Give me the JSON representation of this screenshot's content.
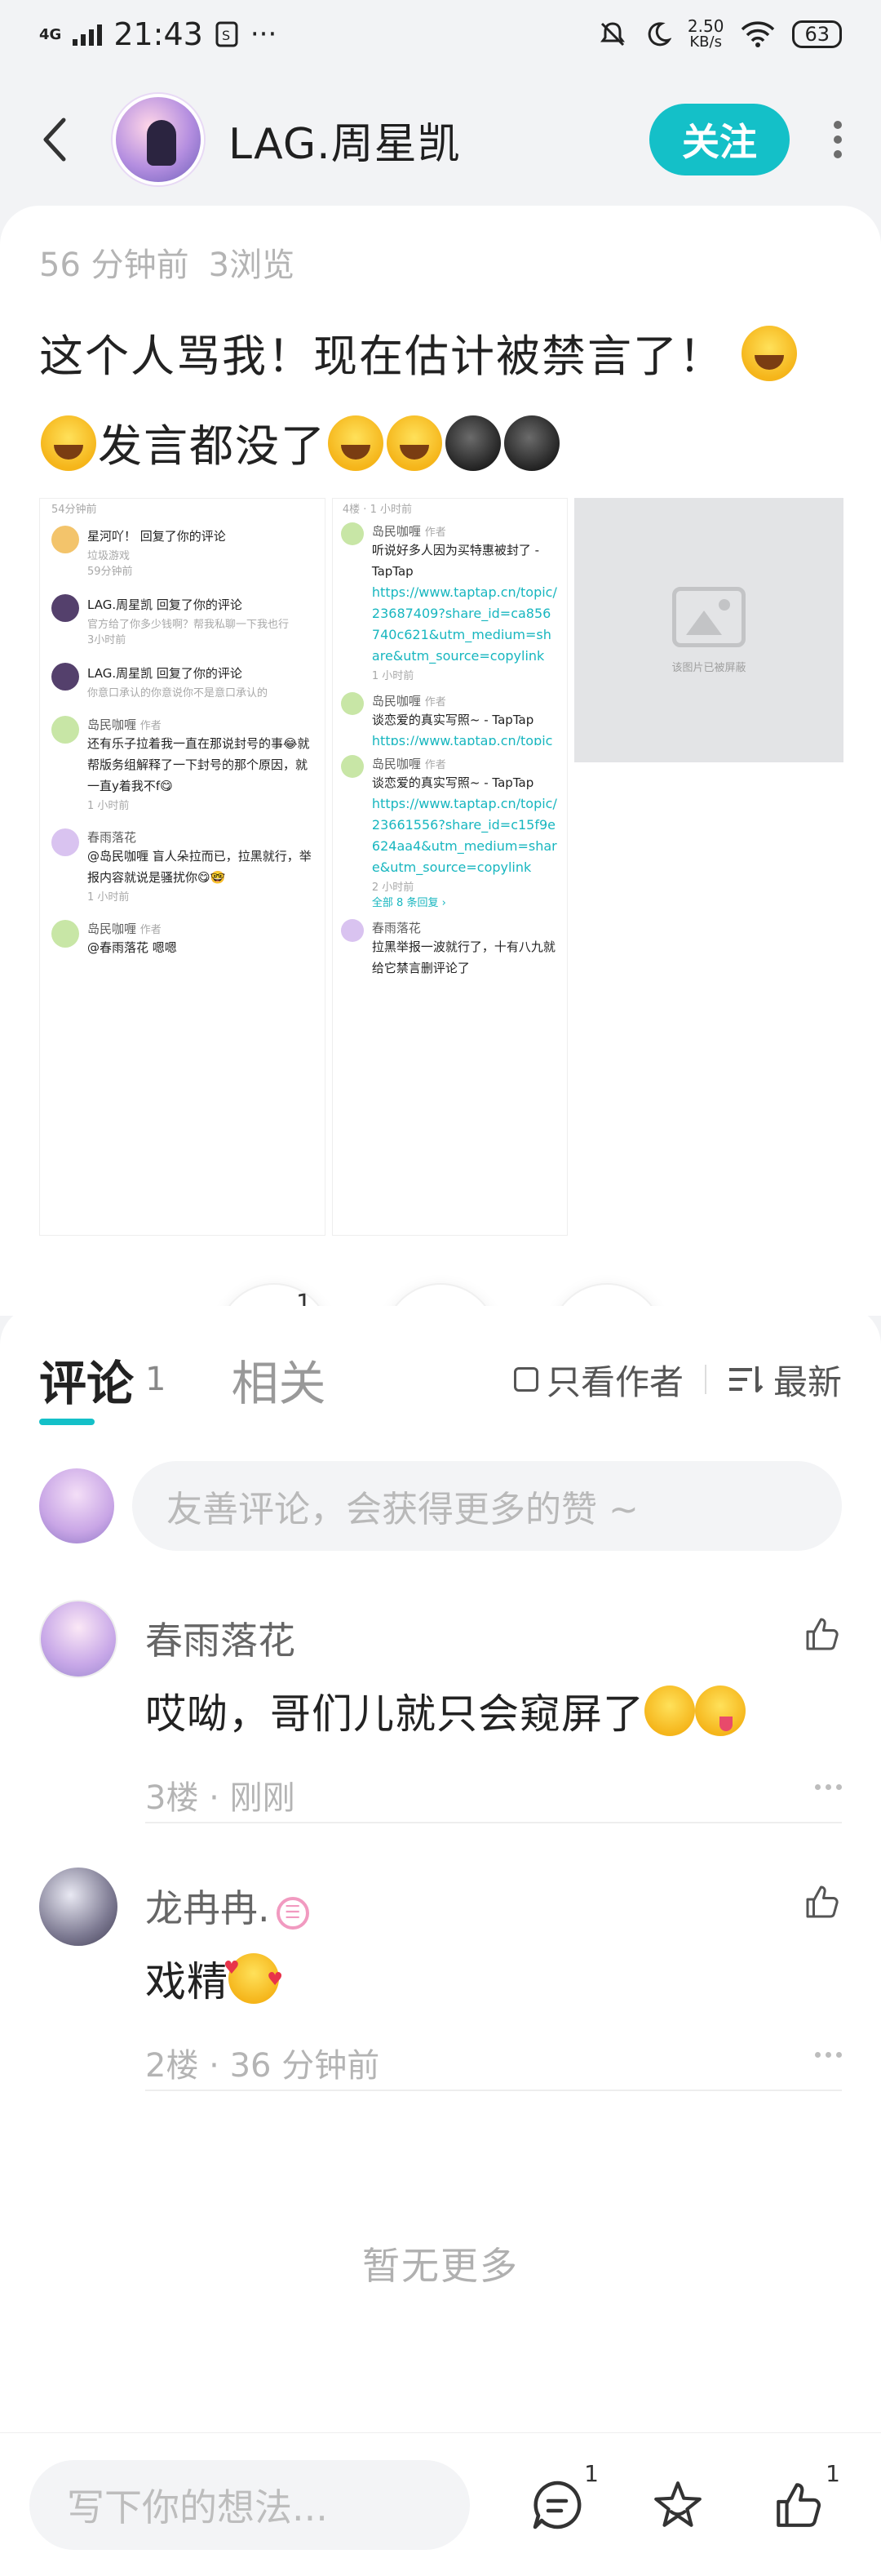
{
  "status_bar": {
    "network": "4G",
    "time": "21:43",
    "speed_value": "2.50",
    "speed_unit": "KB/s",
    "battery": "63"
  },
  "header": {
    "author_name": "LAG.周星凯",
    "follow_label": "关注"
  },
  "post": {
    "age": "56 分钟前",
    "views": "3浏览",
    "text_part1": "这个人骂我！现在估计被禁言了！",
    "text_part2": "发言都没了",
    "likes": "1"
  },
  "screenshot1": {
    "top_time": "54分钟前",
    "n1_title": "星河吖！ 回复了你的评论",
    "n1_text": "垃圾游戏",
    "n1_time": "59分钟前",
    "n2_title": "LAG.周星凯 回复了你的评论",
    "n2_text": "官方给了你多少钱啊？帮我私聊一下我也行",
    "n2_time": "3小时前",
    "n3_title": "LAG.周星凯 回复了你的评论",
    "n3_text": "你意口承认的你意说你不是意口承认的",
    "c1_name": "岛民咖喱",
    "c1_tag": "作者",
    "c1_text": "还有乐子拉着我一直在那说封号的事😂就帮版务组解释了一下封号的那个原因，就一直y着我不f😋",
    "c1_time": "1 小时前",
    "c2_name": "春雨落花",
    "c2_text": "@岛民咖喱 盲人朵拉而已，拉黑就行，举报内容就说是骚扰你😋🤓",
    "c2_time": "1 小时前",
    "c3_name": "岛民咖喱",
    "c3_tag": "作者",
    "c3_text": "@春雨落花  嗯嗯"
  },
  "screenshot2": {
    "top_meta": "4楼 · 1 小时前",
    "a_name": "岛民咖喱",
    "a_tag": "作者",
    "a_text": "听说好多人因为买特惠被封了 - TapTap",
    "a_link": "https://www.taptap.cn/topic/23687409?share_id=ca856740c621&utm_medium=share&utm_source=copylink",
    "a_time": "1 小时前",
    "b_name": "岛民咖喱",
    "b_tag": "作者",
    "b_text": "谈恋爱的真实写照~ - TapTap",
    "b_link": "https://www.taptap.cn/topic",
    "c_name": "岛民咖喱",
    "c_tag": "作者",
    "c_text": "谈恋爱的真实写照~ - TapTap",
    "c_link": "https://www.taptap.cn/topic/23661556?share_id=c15f9e624aa4&utm_medium=share&utm_source=copylink",
    "c_time": "2 小时前",
    "all_replies": "全部 8 条回复 ›",
    "d_name": "春雨落花",
    "d_text": "拉黑举报一波就行了，十有八九就给它禁言删评论了"
  },
  "screenshot3": {
    "blocked_text": "该图片已被屏蔽"
  },
  "comments_section": {
    "tab_comments": "评论",
    "tab_comments_count": "1",
    "tab_related": "相关",
    "only_author": "只看作者",
    "sort_label": "最新",
    "input_placeholder": "友善评论，会获得更多的赞 ~",
    "items": [
      {
        "name": "春雨落花",
        "text": "哎呦，哥们儿就只会窥屏了",
        "floor": "3楼",
        "time": "刚刚"
      },
      {
        "name": "龙冉冉.",
        "text": "戏精",
        "floor": "2楼",
        "time": "36 分钟前"
      }
    ],
    "no_more": "暂无更多"
  },
  "bottom_bar": {
    "placeholder": "写下你的想法...",
    "comment_count": "1",
    "like_count": "1"
  }
}
